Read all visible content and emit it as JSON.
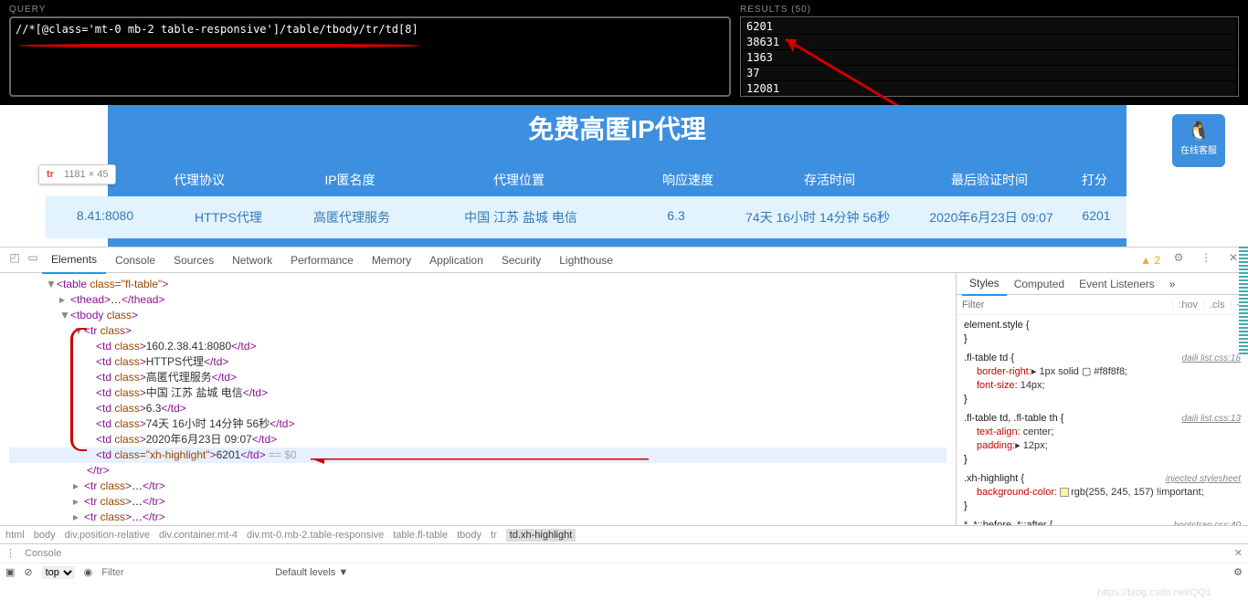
{
  "xpath_helper": {
    "query_label": "QUERY",
    "query_value": "//*[@class='mt-0 mb-2 table-responsive']/table/tbody/tr/td[8]",
    "results_label": "RESULTS (50)",
    "results": [
      "6201",
      "38631",
      "1363",
      "37",
      "12081"
    ]
  },
  "page": {
    "banner_title": "免费高匿IP代理",
    "qq_label": "在线客服",
    "tooltip": {
      "tag": "tr",
      "dimensions": "1181 × 45"
    },
    "headers": [
      "代理协议",
      "IP匿名度",
      "代理位置",
      "响应速度",
      "存活时间",
      "最后验证时间",
      "打分"
    ],
    "row": {
      "ip": "8.41:8080",
      "protocol": "HTTPS代理",
      "anonymity": "高匿代理服务",
      "location": "中国 江苏 盐城 电信",
      "speed": "6.3",
      "alive": "74天 16小时 14分钟 56秒",
      "verified": "2020年6月23日 09:07",
      "score": "6201"
    }
  },
  "devtools": {
    "tabs": [
      "Elements",
      "Console",
      "Sources",
      "Network",
      "Performance",
      "Memory",
      "Application",
      "Security",
      "Lighthouse"
    ],
    "warnings": "2",
    "dom": {
      "table": "<table class=\"fl-table\">",
      "thead": "<thead>…</thead>",
      "tbody": "<tbody class>",
      "tr": "<tr class>",
      "td1": "160.2.38.41:8080",
      "td2": "HTTPS代理",
      "td3": "高匿代理服务",
      "td4": "中国 江苏 盐城 电信",
      "td5": "6.3",
      "td6": "74天 16小时 14分钟 56秒",
      "td7": "2020年6月23日 09:07",
      "td8": "6201",
      "eq50": "== $0",
      "tr_close": "</tr>",
      "tr_more": "<tr class>…</tr>"
    },
    "breadcrumb": [
      "html",
      "body",
      "div.position-relative",
      "div.container.mt-4",
      "div.mt-0.mb-2.table-responsive",
      "table.fl-table",
      "tbody",
      "tr",
      "td.xh-highlight"
    ],
    "styles": {
      "tabs": [
        "Styles",
        "Computed",
        "Event Listeners"
      ],
      "filter_placeholder": "Filter",
      "hov": ":hov",
      "cls": ".cls",
      "element_style": "element.style {",
      "rule1": {
        "selector": ".fl-table td {",
        "src": "daili list.css:18",
        "p1_name": "border-right:",
        "p1_val": "▸ 1px solid ▢ #f8f8f8;",
        "p2_name": "font-size:",
        "p2_val": " 14px;"
      },
      "rule2": {
        "selector": ".fl-table td, .fl-table th {",
        "src": "daili list.css:13",
        "p1_name": "text-align:",
        "p1_val": " center;",
        "p2_name": "padding:",
        "p2_val": "▸ 12px;"
      },
      "rule3": {
        "selector": ".xh-highlight {",
        "src": "injected stylesheet",
        "p1_name": "background-color:",
        "p1_val": "rgb(255, 245, 157) !important;",
        "swatch": "#fff59d"
      },
      "rule4": {
        "selector": "*, *::before, *::after {",
        "src": "bootstrap.css:40"
      }
    },
    "console": {
      "label": "Console",
      "context": "top",
      "filter_placeholder": "Filter",
      "levels": "Default levels ▼"
    }
  },
  "watermark": "https://blog.csdn.net/QQ1"
}
